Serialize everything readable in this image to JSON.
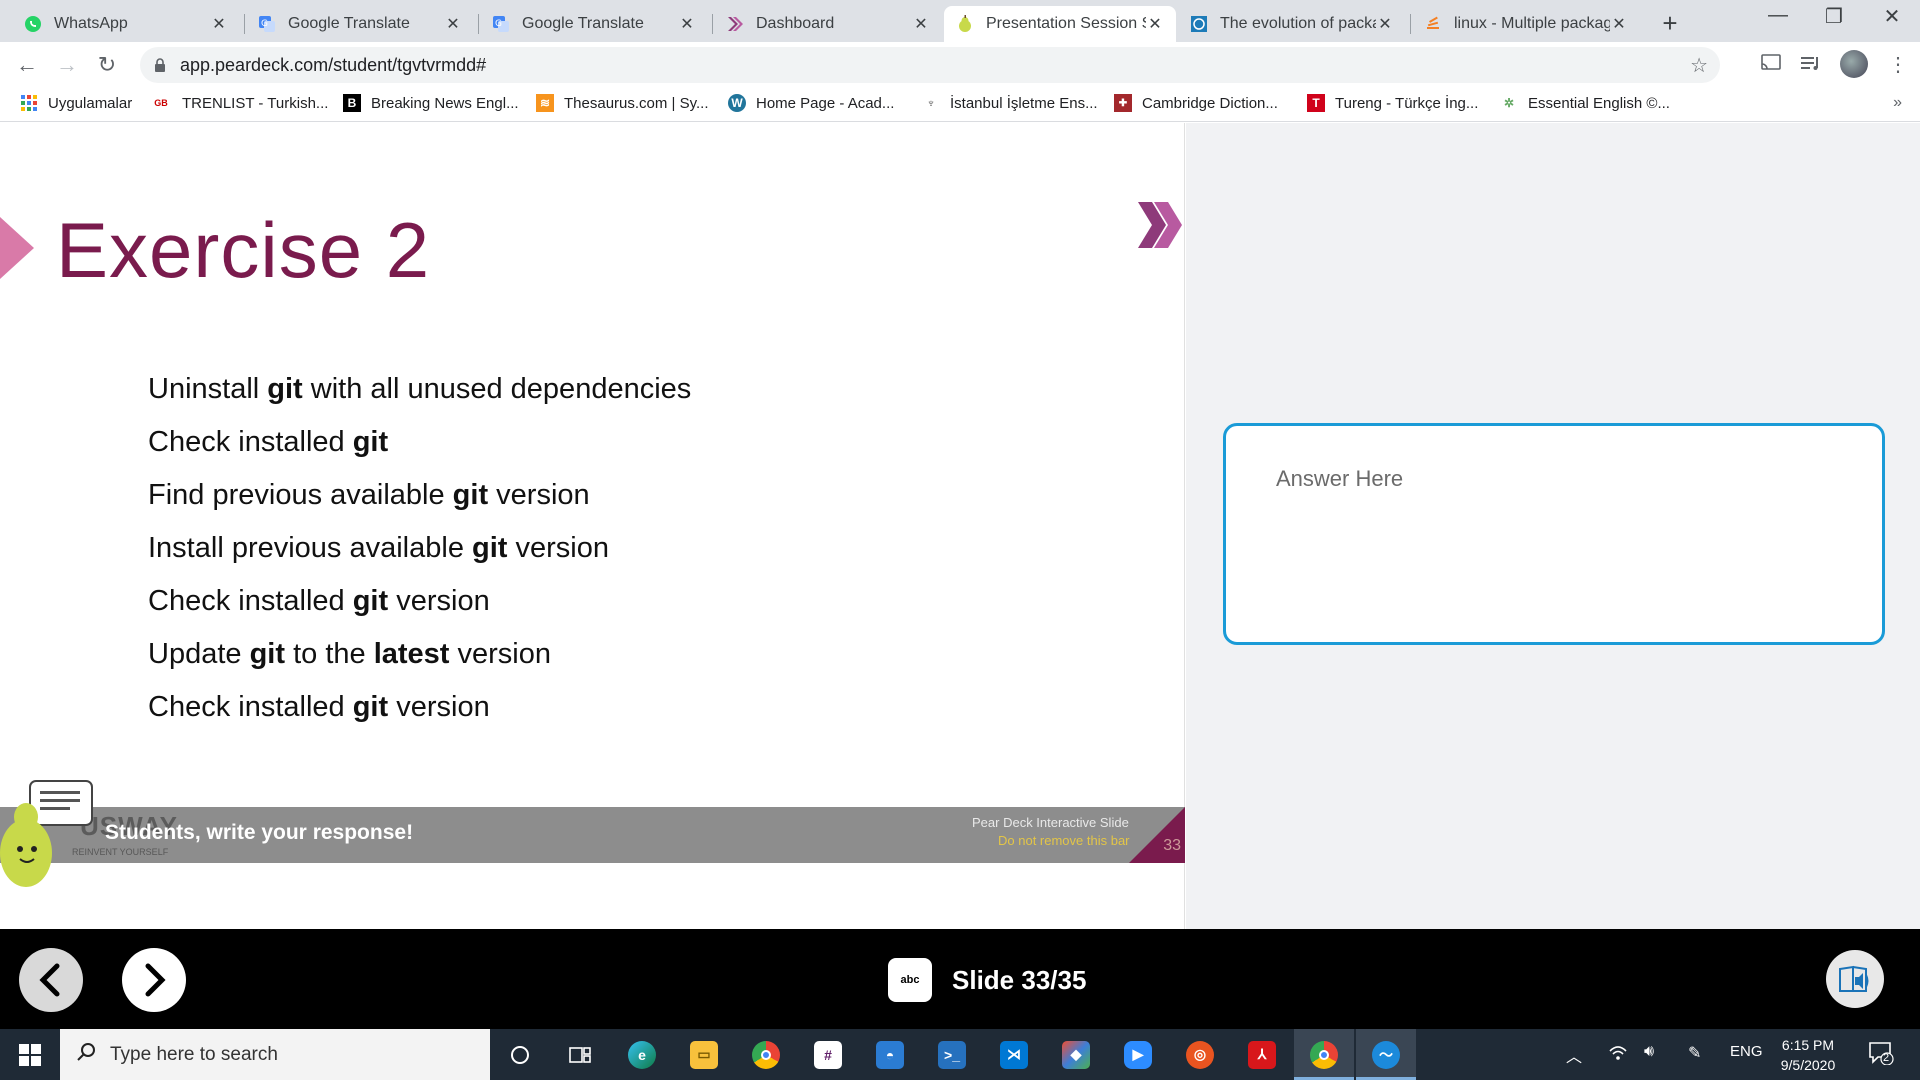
{
  "browser": {
    "tabs": [
      {
        "title": "WhatsApp",
        "icon": "whatsapp-icon",
        "active": false
      },
      {
        "title": "Google Translate",
        "icon": "google-translate-icon",
        "active": false
      },
      {
        "title": "Google Translate",
        "icon": "google-translate-icon",
        "active": false
      },
      {
        "title": "Dashboard",
        "icon": "peardeck-dashboard-icon",
        "active": false
      },
      {
        "title": "Presentation Session St",
        "icon": "pear-icon",
        "active": true
      },
      {
        "title": "The evolution of packa",
        "icon": "globe-tile-icon",
        "active": false
      },
      {
        "title": "linux - Multiple packag",
        "icon": "stackexchange-icon",
        "active": false
      }
    ],
    "url": "app.peardeck.com/student/tgvtvrmdd#",
    "bookmarks": [
      {
        "label": "Uygulamalar",
        "icon": "apps-grid-icon"
      },
      {
        "label": "TRENLIST - Turkish...",
        "icon": "trenlist-icon"
      },
      {
        "label": "Breaking News Engl...",
        "icon": "breaking-news-icon"
      },
      {
        "label": "Thesaurus.com | Sy...",
        "icon": "thesaurus-icon"
      },
      {
        "label": "Home Page - Acad...",
        "icon": "wordpress-icon"
      },
      {
        "label": "İstanbul İşletme Ens...",
        "icon": "iie-icon"
      },
      {
        "label": "Cambridge Diction...",
        "icon": "cambridge-icon"
      },
      {
        "label": "Tureng - Türkçe İng...",
        "icon": "tureng-icon"
      },
      {
        "label": "Essential English ©...",
        "icon": "essential-english-icon"
      }
    ]
  },
  "slide": {
    "title": "Exercise 2",
    "lines": [
      {
        "pre": "Uninstall ",
        "bold": "git",
        "post": " with all unused dependencies"
      },
      {
        "pre": "Check installed ",
        "bold": "git",
        "post": ""
      },
      {
        "pre": "Find previous available ",
        "bold": "git",
        "post": " version"
      },
      {
        "pre": "Install previous available ",
        "bold": "git",
        "post": " version"
      },
      {
        "pre": "Check installed ",
        "bold": "git",
        "post": " version"
      },
      {
        "pre": "Update ",
        "bold": "git",
        "post": " to the ",
        "bold2": "latest",
        "post2": " version"
      },
      {
        "pre": "Check installed ",
        "bold": "git",
        "post": " version"
      }
    ],
    "footer_brand": "USWAY",
    "footer_brand_sub": "REINVENT YOURSELF",
    "footer_prompt": "Students, write your response!",
    "peardeck_label": "Pear Deck Interactive Slide",
    "peardeck_sub": "Do not remove this bar",
    "slide_number": "33"
  },
  "answer": {
    "placeholder": "Answer Here"
  },
  "peardeck_bar": {
    "slide_label": "Slide 33/35",
    "abc": "abc"
  },
  "taskbar": {
    "search_placeholder": "Type here to search",
    "language": "ENG",
    "time": "6:15 PM",
    "date": "9/5/2020",
    "notifications": "2"
  },
  "colors": {
    "title": "#7a1b4d",
    "accent_pink": "#d97aa8",
    "answer_border": "#1a9bd7",
    "taskbar": "#1f2a36"
  }
}
